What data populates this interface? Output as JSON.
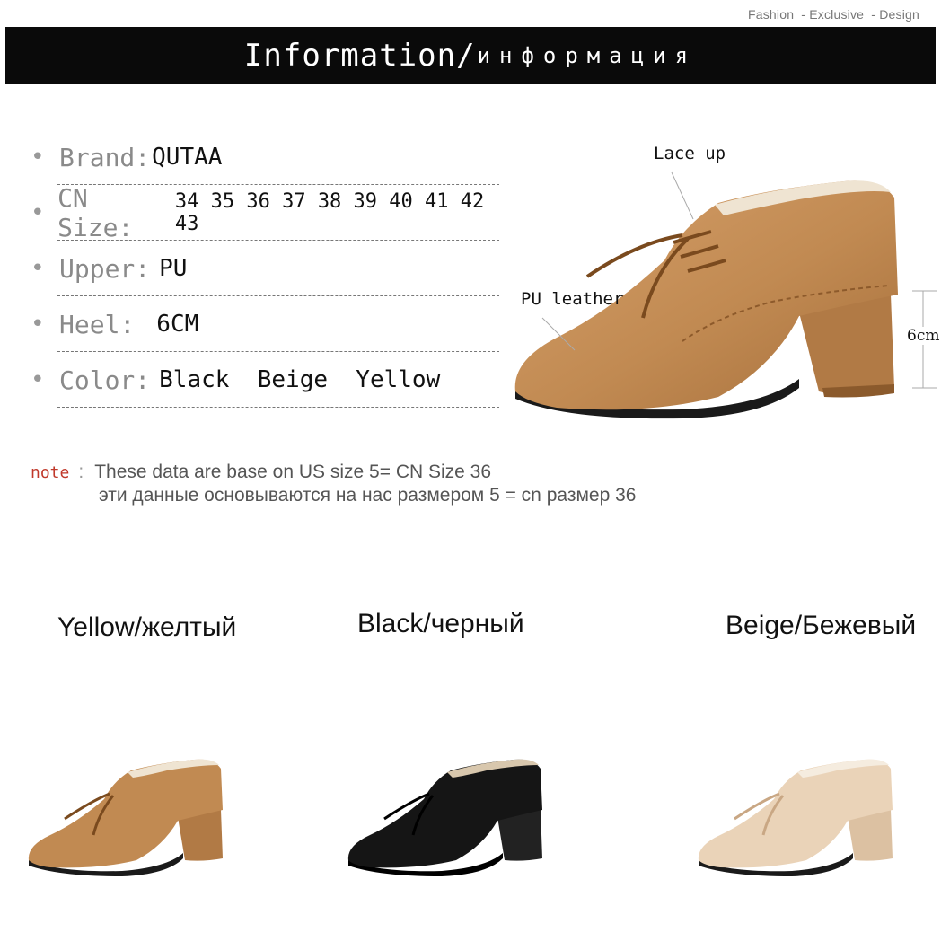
{
  "tagline": [
    "Fashion",
    "- Exclusive",
    "- Design"
  ],
  "banner": {
    "title_en": "Information/",
    "title_ru": "информация"
  },
  "specs": [
    {
      "label": "Brand:",
      "value": "QUTAA"
    },
    {
      "label": "CN Size:",
      "value": "34 35 36 37 38 39 40 41 42 43"
    },
    {
      "label": "Upper:",
      "value": "PU"
    },
    {
      "label": "Heel:",
      "value": "6CM"
    },
    {
      "label": "Color:",
      "value": "Black  Beige  Yellow"
    }
  ],
  "hero": {
    "callout_lace": "Lace up",
    "callout_leather": "PU leather",
    "callout_heel": "6cm"
  },
  "note": {
    "label": "note",
    "line1": "These data are base on US size 5= CN Size 36",
    "line2": "эти данные основываются на нас размером 5 = cn размер 36"
  },
  "colors": [
    {
      "label": "Yellow/желтый",
      "hex": "#c18a52"
    },
    {
      "label": "Black/черный",
      "hex": "#151515"
    },
    {
      "label": "Beige/Бежевый",
      "hex": "#ead3b8"
    }
  ]
}
